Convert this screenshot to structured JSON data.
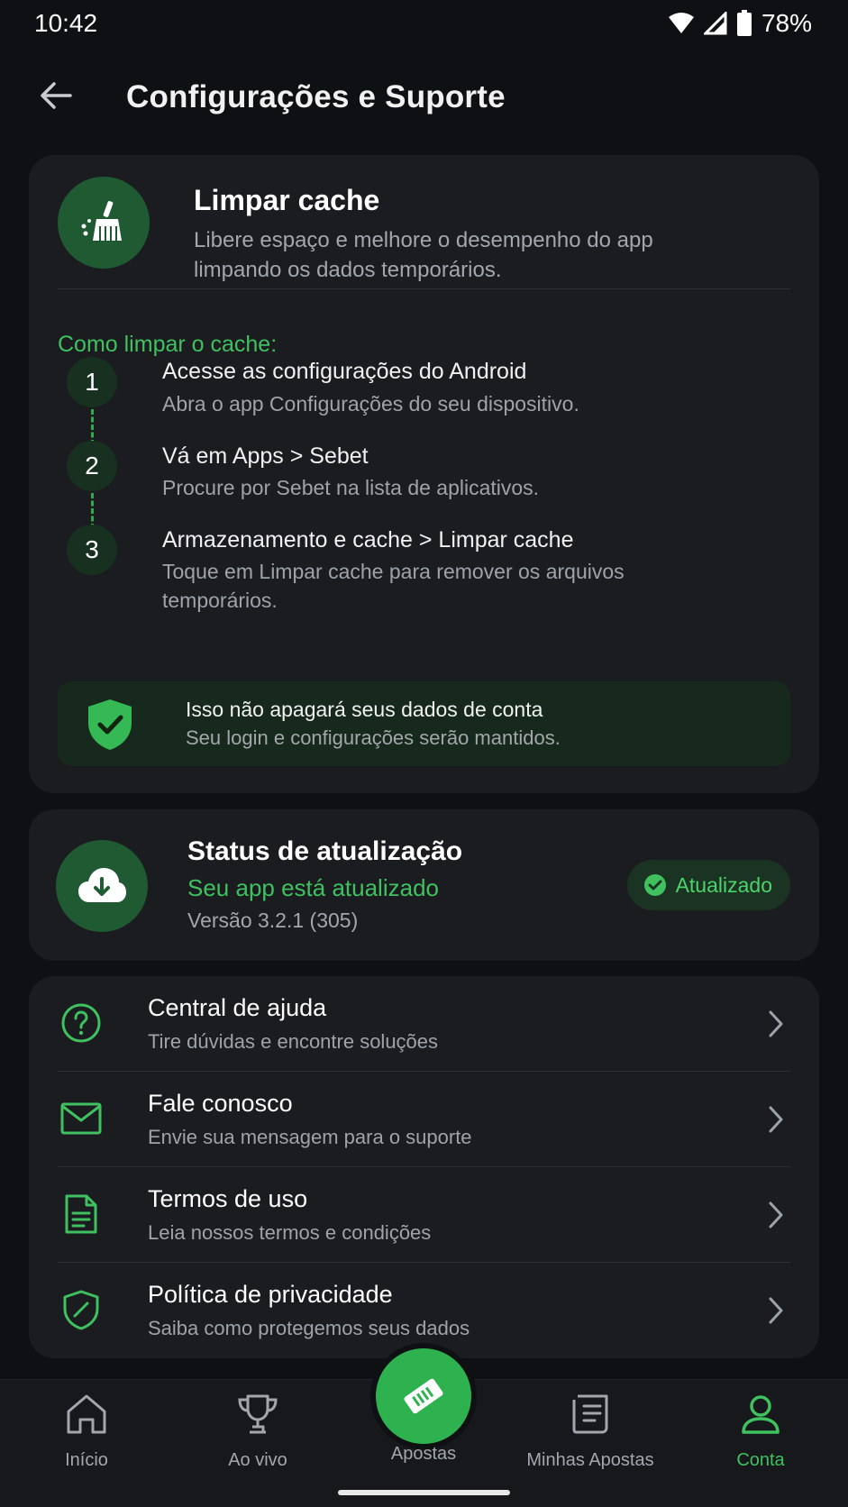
{
  "status_bar": {
    "time": "10:42",
    "battery": "78%"
  },
  "header": {
    "title": "Configurações e Suporte"
  },
  "cache_card": {
    "title": "Limpar cache",
    "description": "Libere espaço e melhore o desempenho do app limpando os dados temporários.",
    "howto_title": "Como limpar o cache:",
    "steps": [
      {
        "number": "1",
        "title": "Acesse as configurações do Android",
        "description": "Abra o app Configurações do seu dispositivo."
      },
      {
        "number": "2",
        "title": "Vá em Apps > Sebet",
        "description": "Procure por Sebet na lista de aplicativos."
      },
      {
        "number": "3",
        "title": "Armazenamento e cache > Limpar cache",
        "description": "Toque em Limpar cache para remover os arquivos temporários."
      }
    ],
    "notice": {
      "title": "Isso não apagará seus dados de conta",
      "description": "Seu login e configurações serão mantidos."
    }
  },
  "update_card": {
    "title": "Status de atualização",
    "subtitle": "Seu app está atualizado",
    "version": "Versão 3.2.1 (305)",
    "badge": "Atualizado"
  },
  "menu": [
    {
      "title": "Central de ajuda",
      "subtitle": "Tire dúvidas e encontre soluções",
      "icon": "help-circle-icon"
    },
    {
      "title": "Fale conosco",
      "subtitle": "Envie sua mensagem para o suporte",
      "icon": "mail-icon"
    },
    {
      "title": "Termos de uso",
      "subtitle": "Leia nossos termos e condições",
      "icon": "document-icon"
    },
    {
      "title": "Política de privacidade",
      "subtitle": "Saiba como protegemos seus dados",
      "icon": "shield-icon"
    }
  ],
  "nav": {
    "items": [
      {
        "label": "Início",
        "icon": "home-icon"
      },
      {
        "label": "Ao vivo",
        "icon": "trophy-icon"
      },
      {
        "label": "Apostas",
        "icon": "ticket-icon"
      },
      {
        "label": "Minhas Apostas",
        "icon": "receipt-icon"
      },
      {
        "label": "Conta",
        "icon": "user-icon",
        "active": true
      }
    ]
  },
  "colors": {
    "accent": "#3fc15f",
    "background": "#0e1013",
    "card": "#1a1c20"
  }
}
